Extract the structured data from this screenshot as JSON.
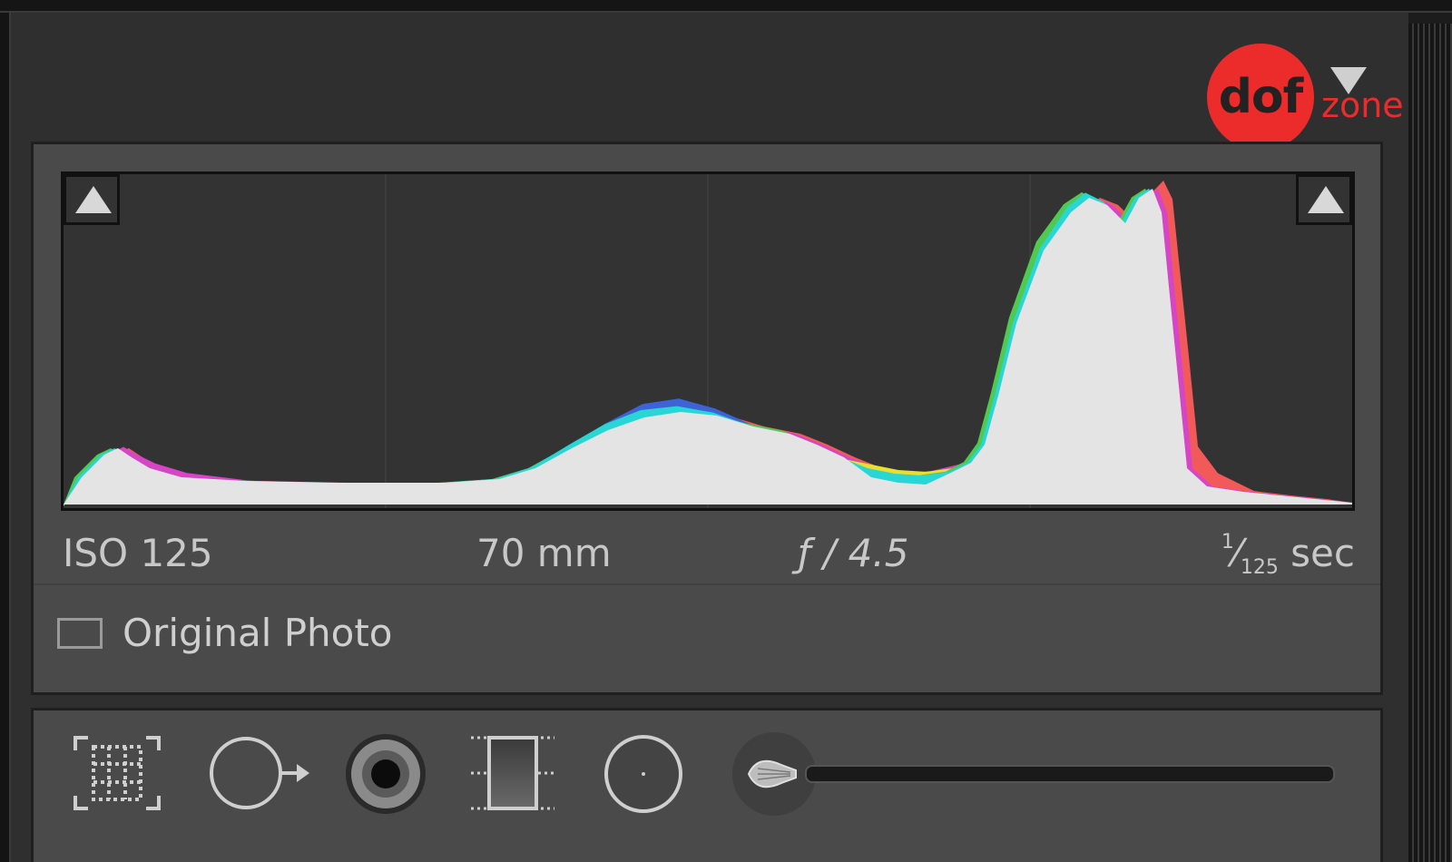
{
  "branding": {
    "circle_text": "dof",
    "side_text": "zone",
    "color": "#ec2b2b"
  },
  "histogram": {
    "channels": [
      "red",
      "green",
      "blue",
      "cyan",
      "magenta",
      "yellow",
      "luminance"
    ],
    "colors": {
      "luminance": "#e4e4e4",
      "red": "#f25a5a",
      "green": "#4fc94f",
      "blue": "#3d63d6",
      "cyan": "#29d6d6",
      "magenta": "#d645c6",
      "yellow": "#e8e02a"
    }
  },
  "exif": {
    "iso": "ISO 125",
    "focal_length": "70 mm",
    "aperture": "ƒ / 4.5",
    "shutter_num": "1",
    "shutter_den": "125",
    "shutter_unit": " sec"
  },
  "original_photo": {
    "label": "Original Photo",
    "checked": false
  },
  "tools": [
    {
      "name": "crop-overlay-tool"
    },
    {
      "name": "spot-removal-tool"
    },
    {
      "name": "red-eye-tool"
    },
    {
      "name": "graduated-filter-tool"
    },
    {
      "name": "radial-filter-tool"
    },
    {
      "name": "adjustment-brush-tool"
    }
  ]
}
